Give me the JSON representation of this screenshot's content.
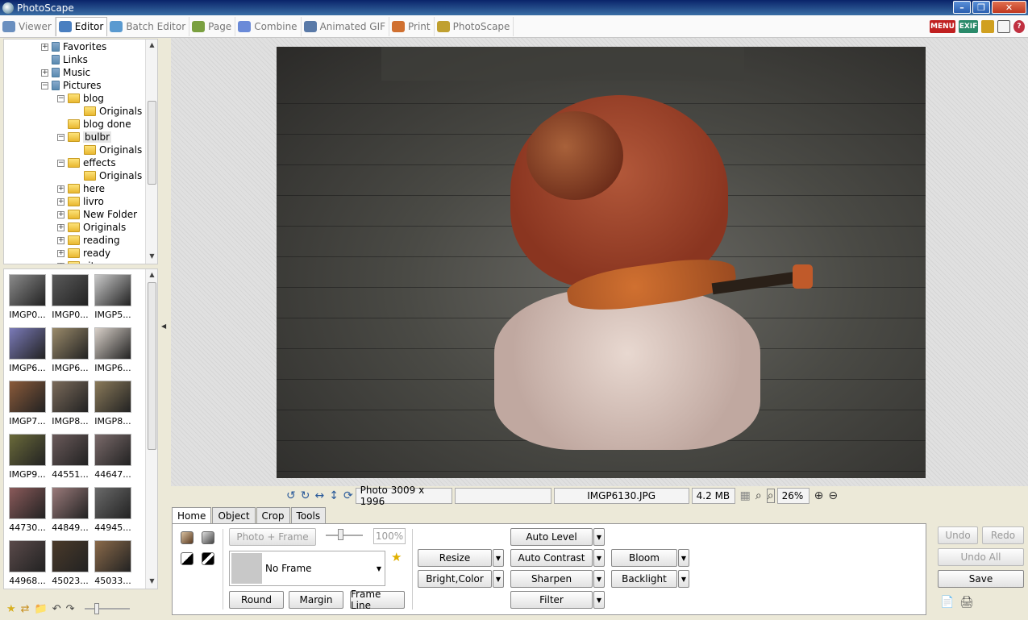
{
  "window": {
    "title": "PhotoScape"
  },
  "app_tabs": [
    {
      "label": "Viewer",
      "color": "#6a8fbf"
    },
    {
      "label": "Editor",
      "color": "#4a7fc0"
    },
    {
      "label": "Batch Editor",
      "color": "#5a9ad0"
    },
    {
      "label": "Page",
      "color": "#7aa040"
    },
    {
      "label": "Combine",
      "color": "#6a8ad8"
    },
    {
      "label": "Animated GIF",
      "color": "#5a7aa8"
    },
    {
      "label": "Print",
      "color": "#d07030"
    },
    {
      "label": "PhotoScape",
      "color": "#c0a030"
    }
  ],
  "active_tab": "Editor",
  "top_right": {
    "menu": "MENU",
    "exif": "EXIF"
  },
  "folder_tree": [
    {
      "label": "Favorites",
      "level": 0,
      "exp": "+"
    },
    {
      "label": "Links",
      "level": 0,
      "exp": ""
    },
    {
      "label": "Music",
      "level": 0,
      "exp": "+"
    },
    {
      "label": "Pictures",
      "level": 0,
      "exp": "-"
    },
    {
      "label": "blog",
      "level": 1,
      "exp": "-"
    },
    {
      "label": "Originals",
      "level": 2,
      "exp": ""
    },
    {
      "label": "blog done",
      "level": 1,
      "exp": ""
    },
    {
      "label": "bulbr",
      "level": 1,
      "exp": "-",
      "selected": true
    },
    {
      "label": "Originals",
      "level": 2,
      "exp": ""
    },
    {
      "label": "effects",
      "level": 1,
      "exp": "-"
    },
    {
      "label": "Originals",
      "level": 2,
      "exp": ""
    },
    {
      "label": "here",
      "level": 1,
      "exp": "+"
    },
    {
      "label": "livro",
      "level": 1,
      "exp": "+"
    },
    {
      "label": "New Folder",
      "level": 1,
      "exp": "+"
    },
    {
      "label": "Originals",
      "level": 1,
      "exp": "+"
    },
    {
      "label": "reading",
      "level": 1,
      "exp": "+"
    },
    {
      "label": "ready",
      "level": 1,
      "exp": "+"
    },
    {
      "label": "site",
      "level": 1,
      "exp": "+"
    }
  ],
  "thumbnails": [
    {
      "label": "IMGP0...",
      "color": "#8a8a8a"
    },
    {
      "label": "IMGP0...",
      "color": "#5a5a5a"
    },
    {
      "label": "IMGP5...",
      "color": "#c8c8c8"
    },
    {
      "label": "IMGP6...",
      "color": "#7a7ab8"
    },
    {
      "label": "IMGP6...",
      "color": "#9a8a6a"
    },
    {
      "label": "IMGP6...",
      "color": "#d8d0c8"
    },
    {
      "label": "IMGP7...",
      "color": "#8a5a3a"
    },
    {
      "label": "IMGP8...",
      "color": "#7a6a5a"
    },
    {
      "label": "IMGP8...",
      "color": "#8a7a5a"
    },
    {
      "label": "IMGP9...",
      "color": "#6a6a3a"
    },
    {
      "label": "44551...",
      "color": "#6a5a5a"
    },
    {
      "label": "44647...",
      "color": "#7a6a6a"
    },
    {
      "label": "44730...",
      "color": "#8a5a5a"
    },
    {
      "label": "44849...",
      "color": "#9a7a7a"
    },
    {
      "label": "44945...",
      "color": "#6a6a6a"
    },
    {
      "label": "44968...",
      "color": "#5a4a4a"
    },
    {
      "label": "45023...",
      "color": "#4a3a2a"
    },
    {
      "label": "45033...",
      "color": "#8a6a4a"
    }
  ],
  "status": {
    "photo_size": "Photo 3009 x 1996",
    "filename": "IMGP6130.JPG",
    "filesize": "4.2 MB",
    "zoom": "26%"
  },
  "panel_tabs": [
    "Home",
    "Object",
    "Crop",
    "Tools"
  ],
  "home": {
    "photo_frame": "Photo + Frame",
    "frame_percent": "100%",
    "frame_name": "No Frame",
    "round": "Round",
    "margin": "Margin",
    "frame_line": "Frame Line",
    "resize": "Resize",
    "bright_color": "Bright,Color",
    "auto_level": "Auto Level",
    "auto_contrast": "Auto Contrast",
    "sharpen": "Sharpen",
    "filter": "Filter",
    "bloom": "Bloom",
    "backlight": "Backlight"
  },
  "actions": {
    "undo": "Undo",
    "redo": "Redo",
    "undo_all": "Undo All",
    "save": "Save"
  }
}
